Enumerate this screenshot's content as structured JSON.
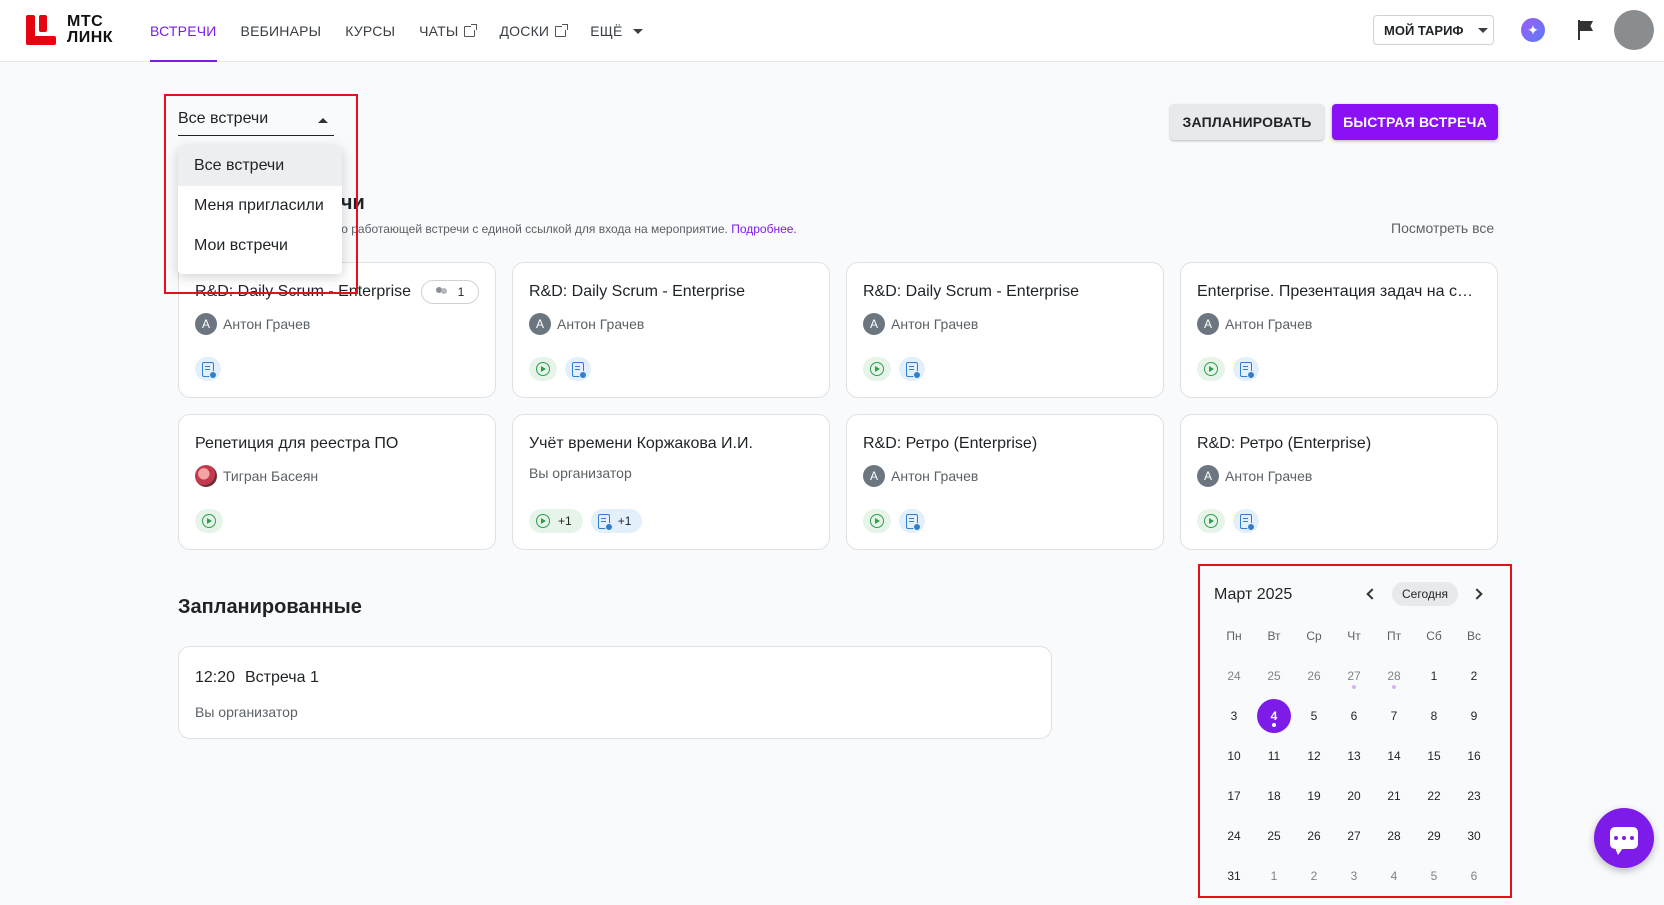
{
  "header": {
    "logo_line1": "МТС",
    "logo_line2": "ЛИНК",
    "nav": [
      {
        "label": "ВСТРЕЧИ"
      },
      {
        "label": "ВЕБИНАРЫ"
      },
      {
        "label": "КУРСЫ"
      },
      {
        "label": "ЧАТЫ"
      },
      {
        "label": "ДОСКИ"
      },
      {
        "label": "ЕЩЁ"
      }
    ],
    "tariff_label": "МОЙ ТАРИФ"
  },
  "filter": {
    "selected": "Все встречи",
    "options": [
      "Все встречи",
      "Меня пригласили",
      "Мои встречи"
    ]
  },
  "actions": {
    "plan_label": "ЗАПЛАНИРОВАТЬ",
    "quick_label": "БЫСТРАЯ ВСТРЕЧА"
  },
  "permanent": {
    "title_visible": "речи",
    "subtitle_visible": "нно работающей встречи с единой ссылкой для входа на мероприятие.",
    "more_link": "Подробнее.",
    "see_all": "Посмотреть все"
  },
  "cards": [
    {
      "title": "R&D: Daily Scrum - Enterprise",
      "owner_initial": "А",
      "owner": "Антон Грачев",
      "members": "1",
      "play": false,
      "doc": true,
      "play_count": "",
      "doc_count": ""
    },
    {
      "title": "R&D: Daily Scrum - Enterprise",
      "owner_initial": "А",
      "owner": "Антон Грачев",
      "play": true,
      "doc": true,
      "play_count": "",
      "doc_count": ""
    },
    {
      "title": "R&D: Daily Scrum - Enterprise",
      "owner_initial": "А",
      "owner": "Антон Грачев",
      "play": true,
      "doc": true,
      "play_count": "",
      "doc_count": ""
    },
    {
      "title": "Enterprise. Презентация задач на спринт",
      "owner_initial": "А",
      "owner": "Антон Грачев",
      "play": true,
      "doc": true,
      "play_count": "",
      "doc_count": ""
    },
    {
      "title": "Репетиция для реестра ПО",
      "owner_initial": "",
      "owner": "Тигран Басеян",
      "play": true,
      "doc": false,
      "play_count": "",
      "doc_count": ""
    },
    {
      "title": "Учёт времени Коржакова И.И.",
      "owner_initial": "",
      "owner": "Вы организатор",
      "play": true,
      "doc": true,
      "play_count": "+1",
      "doc_count": "+1"
    },
    {
      "title": "R&D: Ретро (Enterprise)",
      "owner_initial": "А",
      "owner": "Антон Грачев",
      "play": true,
      "doc": true,
      "play_count": "",
      "doc_count": ""
    },
    {
      "title": "R&D: Ретро (Enterprise)",
      "owner_initial": "А",
      "owner": "Антон Грачев",
      "play": true,
      "doc": true,
      "play_count": "",
      "doc_count": ""
    }
  ],
  "scheduled": {
    "title": "Запланированные",
    "items": [
      {
        "time": "12:20",
        "title": "Встреча 1",
        "organizer": "Вы организатор"
      }
    ]
  },
  "calendar": {
    "month": "Март 2025",
    "today_label": "Сегодня",
    "weekdays": [
      "Пн",
      "Вт",
      "Ср",
      "Чт",
      "Пт",
      "Сб",
      "Вс"
    ],
    "weeks": [
      [
        "24",
        "25",
        "26",
        "27",
        "28",
        "1",
        "2"
      ],
      [
        "3",
        "4",
        "5",
        "6",
        "7",
        "8",
        "9"
      ],
      [
        "10",
        "11",
        "12",
        "13",
        "14",
        "15",
        "16"
      ],
      [
        "17",
        "18",
        "19",
        "20",
        "21",
        "22",
        "23"
      ],
      [
        "24",
        "25",
        "26",
        "27",
        "28",
        "29",
        "30"
      ],
      [
        "31",
        "1",
        "2",
        "3",
        "4",
        "5",
        "6"
      ]
    ],
    "selected_day": "4"
  },
  "colors": {
    "accent": "#7d1ce8",
    "brand_red": "#e30611",
    "highlight": "#e4111c"
  }
}
